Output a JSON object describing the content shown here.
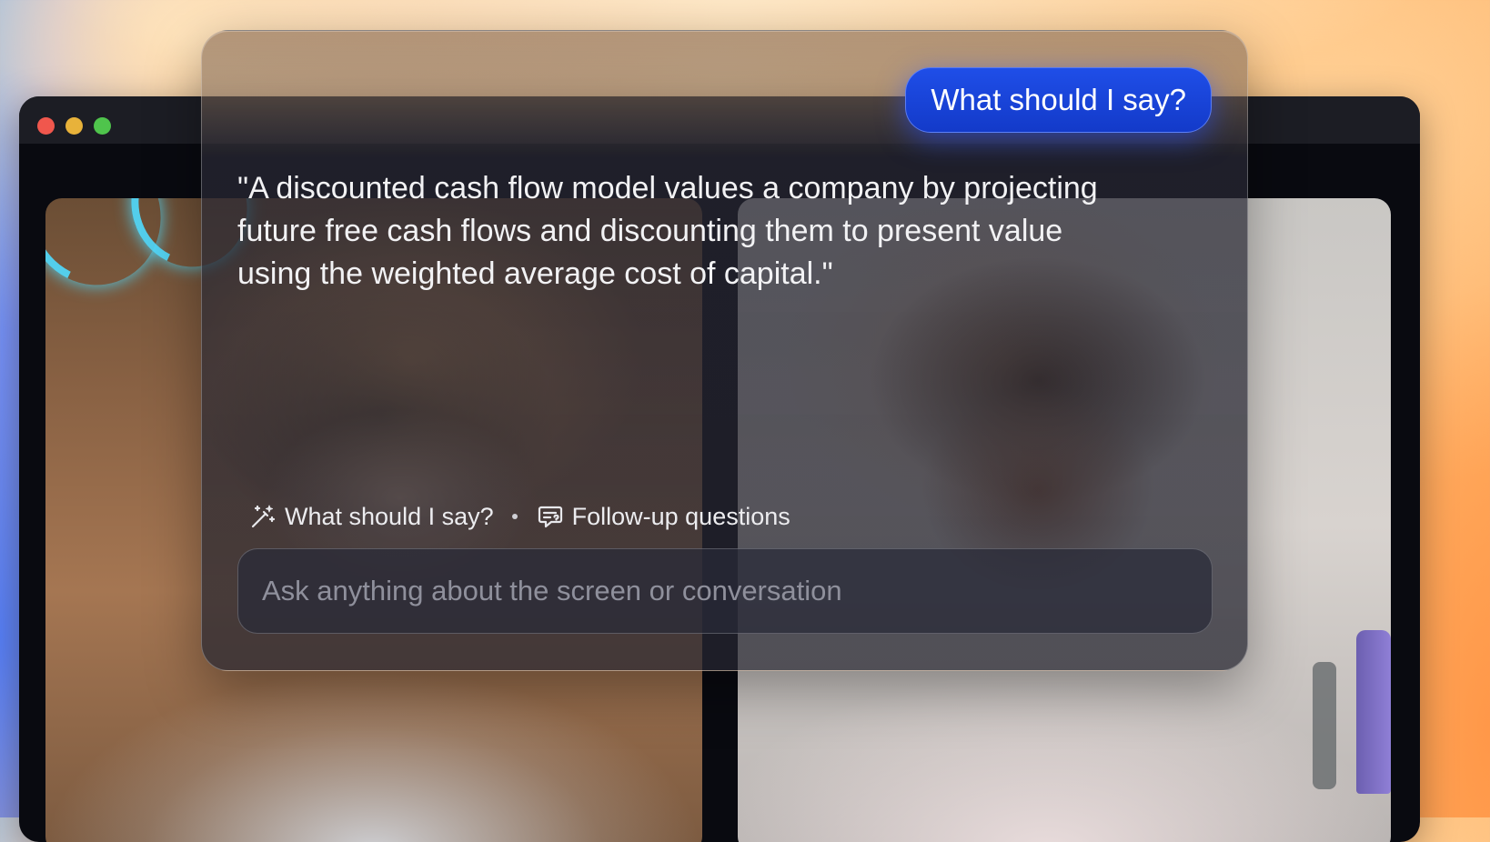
{
  "assistant": {
    "prompt_bubble": "What should I say?",
    "answer": "\"A discounted cash flow model values a company by projecting future free cash flows and discounting them to present value using the weighted average cost of capital.\"",
    "actions": {
      "what_to_say": {
        "label": "What should I say?",
        "icon": "magic-wand-icon"
      },
      "follow_up": {
        "label": "Follow-up questions",
        "icon": "chat-question-icon"
      }
    },
    "input": {
      "placeholder": "Ask anything about the screen or conversation",
      "value": ""
    }
  },
  "colors": {
    "bubble": "#1a45dd",
    "panel": "#26262f",
    "text": "#f2f2f4"
  }
}
